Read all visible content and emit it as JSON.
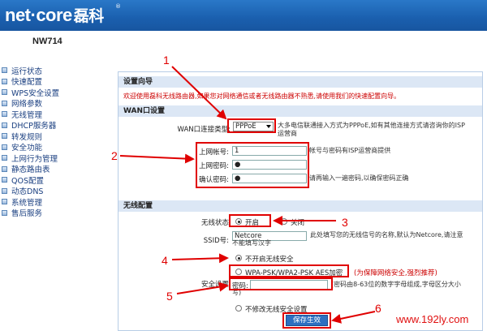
{
  "header": {
    "logo_en": "net·core",
    "logo_cn": "磊科",
    "reg": "®",
    "model": "NW714"
  },
  "sidebar": {
    "items": [
      {
        "label": "运行状态"
      },
      {
        "label": "快速配置"
      },
      {
        "label": "WPS安全设置"
      },
      {
        "label": "网络参数"
      },
      {
        "label": "无线管理"
      },
      {
        "label": "DHCP服务器"
      },
      {
        "label": "转发规则"
      },
      {
        "label": "安全功能"
      },
      {
        "label": "上网行为管理"
      },
      {
        "label": "静态路由表"
      },
      {
        "label": "QOS配置"
      },
      {
        "label": "动态DNS"
      },
      {
        "label": "系统管理"
      },
      {
        "label": "售后服务"
      }
    ]
  },
  "wizard": {
    "title": "设置向导",
    "hint": "欢迎使用磊科无线路由器,如果您对网络通信或者无线路由器不熟悉,请使用我们的快速配置向导。"
  },
  "wan": {
    "title": "WAN口设置",
    "type_label": "WAN口连接类型:",
    "type_value": "PPPoE",
    "type_note_1": "大多电信联通接入方式为PPPoE,如有其他连接方式请咨询你的ISP",
    "type_note_2": "运营商",
    "account_label": "上网帐号:",
    "account_value": "1",
    "account_note": "帐号与密码有ISP运营商提供",
    "password_label": "上网密码:",
    "password_value": "●",
    "confirm_label": "确认密码:",
    "confirm_value": "●",
    "confirm_note": "请再输入一遍密码,以确保密码正确"
  },
  "wireless": {
    "title": "无线配置",
    "status_label": "无线状态",
    "status_on": "开启",
    "status_off": "关闭",
    "ssid_label": "SSID号:",
    "ssid_value": "Netcore",
    "ssid_note_1": "此处填写您的无线信号的名称,默认为Netcore,请注意",
    "ssid_note_2": "不能填写汉字",
    "security_label": "安全设置",
    "sec_option_none": "不开启无线安全",
    "sec_option_wpa": "WPA-PSK/WPA2-PSK AES加密",
    "sec_option_wpa_note": "(为保障网络安全,强烈推荐)",
    "key_label": "密码:",
    "key_note_1": "(密码由8-63位的数字字母组成,字母区分大小",
    "key_note_2": "写)",
    "sec_option_keep": "不修改无线安全设置"
  },
  "save_label": "保存生效",
  "annotations": [
    "1",
    "2",
    "3",
    "4",
    "5",
    "6"
  ],
  "watermark": "www.192ly.com",
  "colors": {
    "header": "#1a5fae",
    "section": "#dce7f5",
    "accent_red": "#e00000",
    "button": "#2d6fc0"
  }
}
